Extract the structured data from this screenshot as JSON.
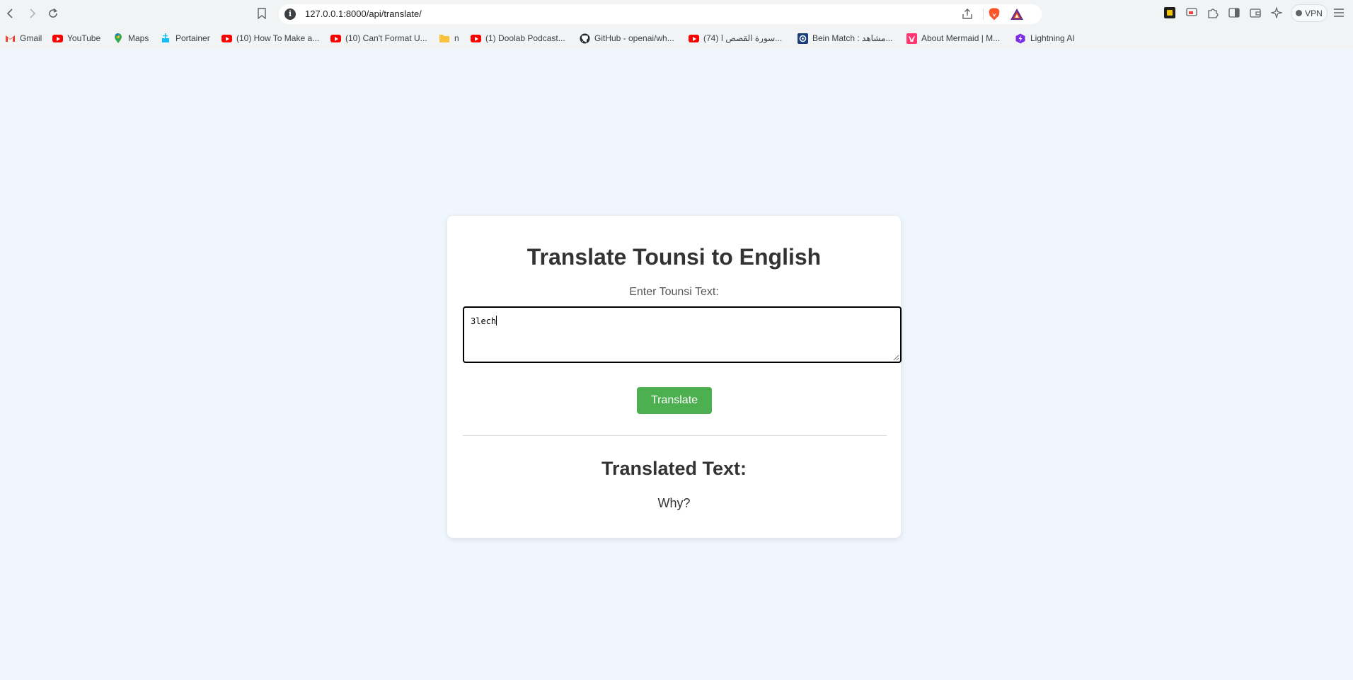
{
  "browser": {
    "url": "127.0.0.1:8000/api/translate/",
    "vpn_label": "VPN"
  },
  "bookmarks": [
    {
      "label": "Gmail",
      "icon": "gmail-icon"
    },
    {
      "label": "YouTube",
      "icon": "youtube-icon"
    },
    {
      "label": "Maps",
      "icon": "maps-icon"
    },
    {
      "label": "Portainer",
      "icon": "portainer-icon"
    },
    {
      "label": "(10) How To Make a...",
      "icon": "youtube-icon"
    },
    {
      "label": "(10) Can't Format U...",
      "icon": "youtube-icon"
    },
    {
      "label": "n",
      "icon": "folder-icon"
    },
    {
      "label": "(1) Doolab Podcast...",
      "icon": "youtube-icon"
    },
    {
      "label": "GitHub - openai/wh...",
      "icon": "github-icon"
    },
    {
      "label": "(74) سورة القصص ا...",
      "icon": "youtube-icon"
    },
    {
      "label": "Bein Match : مشاهد...",
      "icon": "bein-icon"
    },
    {
      "label": "About Mermaid | M...",
      "icon": "mermaid-icon"
    },
    {
      "label": "Lightning AI",
      "icon": "lightning-icon"
    }
  ],
  "colors": {
    "page_background": "#eff6fd",
    "button": "#4caf50",
    "heading": "#333333"
  },
  "page": {
    "title": "Translate Tounsi to English",
    "input_label": "Enter Tounsi Text:",
    "input_value": "3lech",
    "button_label": "Translate",
    "result_heading": "Translated Text:",
    "result_text": "Why?"
  }
}
